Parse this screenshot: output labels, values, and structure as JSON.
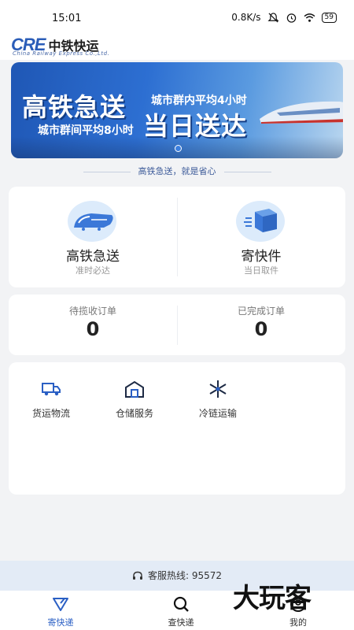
{
  "status_bar": {
    "time": "15:01",
    "net_speed": "0.8K/s",
    "battery": "59"
  },
  "header": {
    "logo_en_short": "CRE",
    "logo_cn": "中铁快运",
    "logo_en_full": "China Railway Express Co.,Ltd."
  },
  "banner": {
    "headline_1": "高铁急送",
    "subline_1": "城市群内平均4小时",
    "subline_2": "城市群间平均8小时",
    "headline_2": "当日送达"
  },
  "slogan": "高铁急送，就是省心",
  "services": [
    {
      "title": "高铁急送",
      "subtitle": "准时必达",
      "icon": "train-icon"
    },
    {
      "title": "寄快件",
      "subtitle": "当日取件",
      "icon": "package-icon"
    }
  ],
  "orders": [
    {
      "label": "待揽收订单",
      "value": "0"
    },
    {
      "label": "已完成订单",
      "value": "0"
    }
  ],
  "quick_services": [
    {
      "label": "货运物流",
      "icon": "truck-icon"
    },
    {
      "label": "仓储服务",
      "icon": "warehouse-icon"
    },
    {
      "label": "冷链运输",
      "icon": "snowflake-icon"
    }
  ],
  "hotline": "客服热线: 95572",
  "tabs": [
    {
      "label": "寄快递",
      "icon": "send-icon",
      "active": true
    },
    {
      "label": "查快递",
      "icon": "search-icon",
      "active": false
    },
    {
      "label": "我的",
      "icon": "user-icon",
      "active": false
    }
  ],
  "watermark": "大玩客",
  "colors": {
    "accent": "#2a5fc4",
    "banner": "#2d6fd2",
    "icon_circle": "#dcebfb",
    "hotline_bg": "#e3ebf6"
  }
}
